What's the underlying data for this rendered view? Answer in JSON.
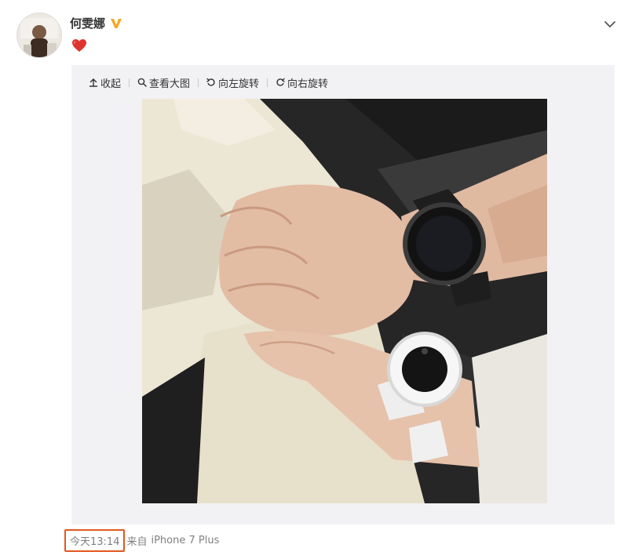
{
  "post": {
    "username": "何雯娜",
    "verified_icon": "vip-v-icon",
    "content_emoji": "red-heart-icon",
    "expand_icon": "chevron-down-icon"
  },
  "toolbar": {
    "collapse_label": "收起",
    "view_large_label": "查看大图",
    "rotate_left_label": "向左旋转",
    "rotate_right_label": "向右旋转"
  },
  "footer": {
    "time": "今天13:14",
    "via": "来自",
    "device": "iPhone 7 Plus"
  },
  "colors": {
    "highlight_border": "#e2571e",
    "verified": "#f5a623",
    "heart": "#e0332f",
    "panel_bg": "#f2f2f5"
  }
}
